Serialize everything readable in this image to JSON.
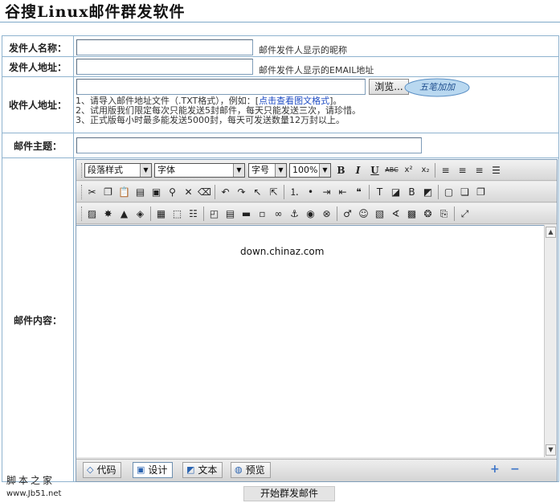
{
  "page": {
    "title": "谷搜Linux邮件群发软件"
  },
  "form": {
    "sender_name": {
      "label": "发件人名称：",
      "value": "",
      "hint": "邮件发件人显示的昵称"
    },
    "sender_address": {
      "label": "发件人地址：",
      "value": "",
      "hint": "邮件发件人显示的EMAIL地址"
    },
    "recipient_address": {
      "label": "收件人地址：",
      "value": "",
      "browse_label": "浏览...",
      "badge_text": "五笔加加",
      "notes": [
        {
          "text": "1、请导入邮件地址文件（.TXT格式），例如：[",
          "link": "点击查看图文格式",
          "suffix": "]。"
        },
        {
          "text": "2、试用版我们限定每次只能发送5封邮件，每天只能发送三次，请珍惜。",
          "link": "",
          "suffix": ""
        },
        {
          "text": "3、正式版每小时最多能发送5000封，每天可发送数量12万封以上。",
          "link": "",
          "suffix": ""
        }
      ]
    },
    "subject": {
      "label": "邮件主题：",
      "value": ""
    },
    "content": {
      "label": "邮件内容："
    }
  },
  "editor": {
    "toolbar": {
      "paragraph_style": "段落样式",
      "font": "字体",
      "font_size": "字号",
      "zoom": "100%",
      "bold": "B",
      "italic": "I",
      "underline": "U",
      "strike": "ABC",
      "superscript": "x²",
      "subscript": "x₂"
    },
    "body_text": "down.chinaz.com",
    "tabs": [
      {
        "label": "代码",
        "icon": "code-icon",
        "active": false
      },
      {
        "label": "设计",
        "icon": "design-icon",
        "active": true
      },
      {
        "label": "文本",
        "icon": "text-icon",
        "active": false
      },
      {
        "label": "预览",
        "icon": "preview-icon",
        "active": false
      }
    ],
    "expand": "+",
    "shrink": "−"
  },
  "footer": {
    "site_name": "脚本之家",
    "site_url": "www.Jb51.net",
    "submit_label": "开始群发邮件"
  },
  "colors": {
    "border": "#8fb3cf",
    "link": "#1f4cc4"
  }
}
